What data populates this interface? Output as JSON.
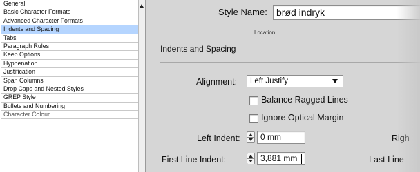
{
  "categories": [
    "General",
    "Basic Character Formats",
    "Advanced Character Formats",
    "Indents and Spacing",
    "Tabs",
    "Paragraph Rules",
    "Keep Options",
    "Hyphenation",
    "Justification",
    "Span Columns",
    "Drop Caps and Nested Styles",
    "GREP Style",
    "Bullets and Numbering",
    "Character Colour"
  ],
  "selected_category": "Indents and Spacing",
  "style_name": {
    "label": "Style Name:",
    "value": "brød indryk"
  },
  "location_label": "Location:",
  "section_title": "Indents and Spacing",
  "alignment": {
    "label": "Alignment:",
    "value": "Left Justify"
  },
  "options": {
    "balance_ragged_lines": {
      "label": "Balance Ragged Lines",
      "checked": false
    },
    "ignore_optical_margin": {
      "label": "Ignore Optical Margin",
      "checked": false
    }
  },
  "left_indent": {
    "label": "Left Indent:",
    "value": "0 mm"
  },
  "first_line_indent": {
    "label": "First Line Indent:",
    "value": "3,881 mm"
  },
  "right_indent": {
    "label": "Righ"
  },
  "last_line_indent": {
    "label": "Last Line"
  },
  "colors": {
    "selection": "#b5d5ff",
    "panel": "#d6d6d6"
  }
}
